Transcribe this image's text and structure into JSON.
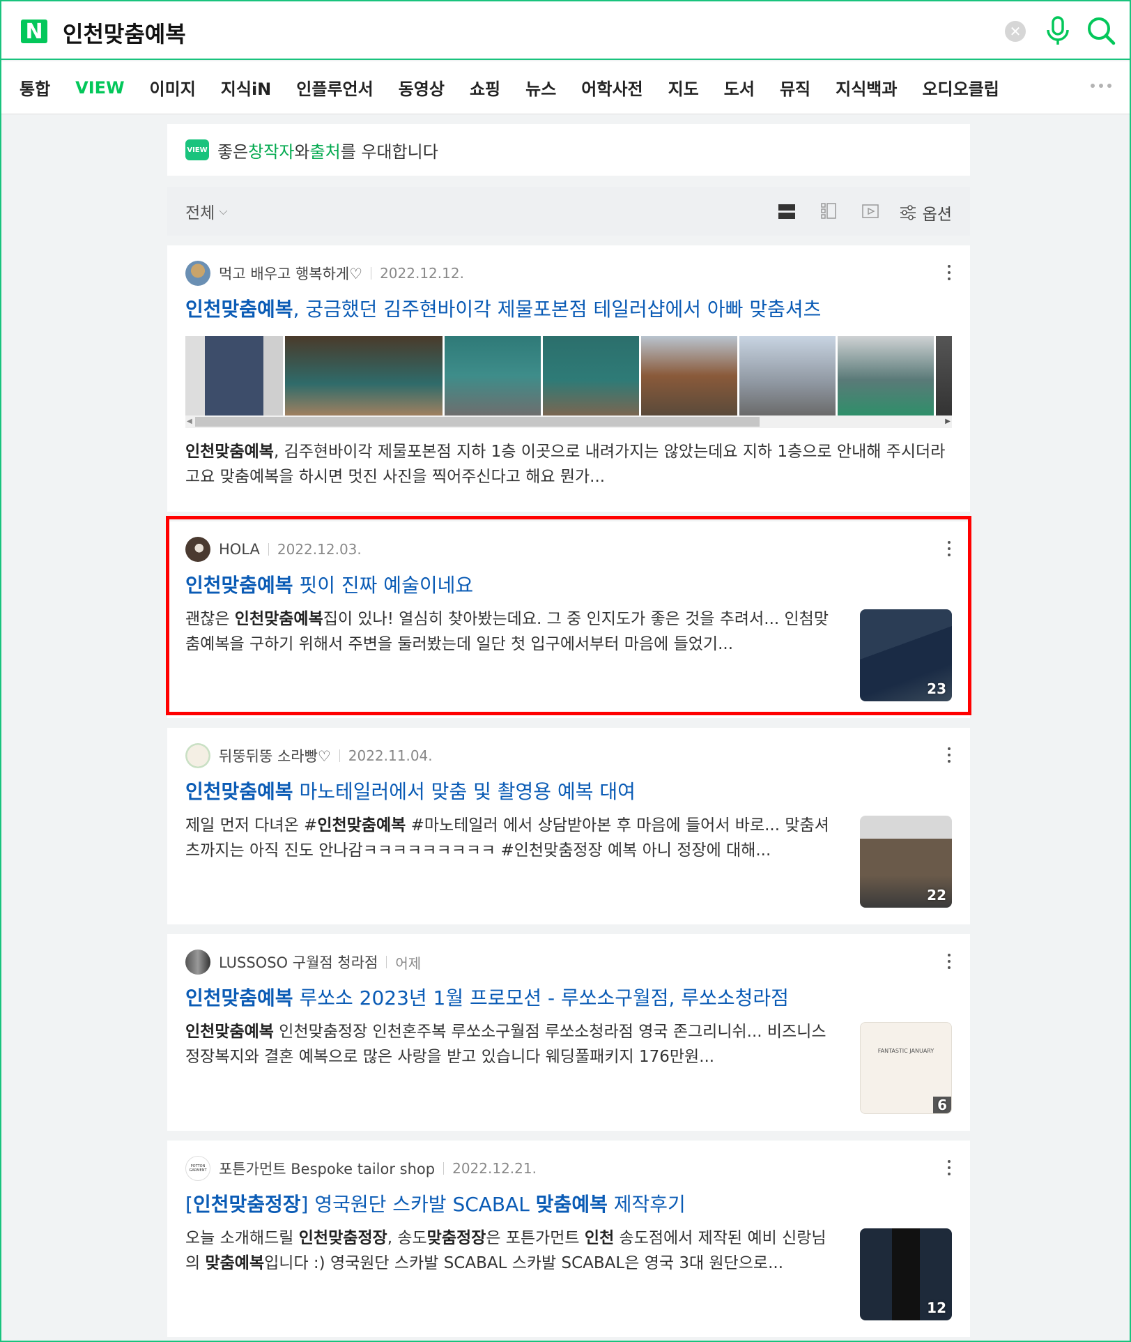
{
  "search": {
    "logo": "N",
    "query": "인천맞춤예복",
    "clear_icon": "close-icon",
    "mic_icon": "mic-icon",
    "search_icon": "search-icon",
    "accent": "#03c75a"
  },
  "nav": {
    "items": [
      "통합",
      "VIEW",
      "이미지",
      "지식iN",
      "인플루언서",
      "동영상",
      "쇼핑",
      "뉴스",
      "어학사전",
      "지도",
      "도서",
      "뮤직",
      "지식백과",
      "오디오클립"
    ],
    "active": "VIEW"
  },
  "notice": {
    "badge": "VIEW",
    "text_1": "좋은 ",
    "green_1": "창작자",
    "text_2": "와 ",
    "green_2": "출처",
    "text_3": "를 우대합니다"
  },
  "filter": {
    "label": "전체",
    "options_label": "옵션"
  },
  "results": [
    {
      "author": "먹고 배우고 행복하게♡",
      "date": "2022.12.12.",
      "title_bold": "인천맞춤예복",
      "title_rest": ", 궁금했던 김주현바이각 제물포본점 테일러샵에서 아빠 맞춤셔츠",
      "desc_bold": "인천맞춤예복",
      "desc_rest": ", 김주현바이각 제물포본점 지하 1층 이곳으로 내려가지는 않았는데요 지하 1층으로 안내해 주시더라고요 맞춤예복을 하시면 멋진 사진을 찍어주신다고 해요 뭔가..."
    },
    {
      "author": "HOLA",
      "date": "2022.12.03.",
      "title_bold": "인천맞춤예복",
      "title_rest": " 핏이 진짜 예술이네요",
      "desc_pre": "괜찮은 ",
      "desc_bold": "인천맞춤예복",
      "desc_rest": "집이 있나! 열심히 찾아봤는데요. 그 중 인지도가 좋은 것을 추려서... 인첨맞춤예복을 구하기 위해서 주변을 둘러봤는데 일단 첫 입구에서부터 마음에 들었기...",
      "count": "23"
    },
    {
      "author": "뒤뚱뒤뚱 소라빵♡",
      "date": "2022.11.04.",
      "title_bold": "인천맞춤예복",
      "title_rest": " 마노테일러에서 맞춤 및 촬영용 예복 대여",
      "desc_pre": "제일 먼저 다녀온 #",
      "desc_bold": "인천맞춤예복",
      "desc_rest": " #마노테일러 에서 상담받아본 후 마음에 들어서 바로... 맞춤셔츠까지는 아직 진도 안나감ㅋㅋㅋㅋㅋㅋㅋㅋㅋ #인천맞춤정장 예복 아니 정장에 대해...",
      "count": "22"
    },
    {
      "author": "LUSSOSO 구월점 청라점",
      "date": "어제",
      "title_bold": "인천맞춤예복",
      "title_rest": " 루쏘소 2023년 1월 프로모션 - 루쏘소구월점, 루쏘소청라점",
      "desc_pre": "",
      "desc_bold": "인천맞춤예복",
      "desc_rest": " 인천맞춤정장 인천혼주복 루쏘소구월점 루쏘소청라점 영국 존그리니쉬... 비즈니스 정장복지와 결혼 예복으로 많은 사랑을 받고 있습니다 웨딩풀패키지 176만원...",
      "count": "6",
      "thumb_text": "FANTASTIC JANUARY"
    },
    {
      "author": "포튼가먼트 Bespoke tailor shop",
      "date": "2022.12.21.",
      "title_pre": "[",
      "title_bold": "인천맞춤정장",
      "title_mid": "] 영국원단 스카발 SCABAL ",
      "title_bold2": "맞춤예복",
      "title_rest": " 제작후기",
      "desc_1": "오늘 소개해드릴 ",
      "desc_b1": "인천맞춤정장",
      "desc_2": ", 송도",
      "desc_b2": "맞춤정장",
      "desc_3": "은 포튼가먼트 ",
      "desc_b3": "인천",
      "desc_4": " 송도점에서 제작된 예비 신랑님의 ",
      "desc_b4": "맞춤예복",
      "desc_5": "입니다 :) 영국원단 스카발 SCABAL 스카발 SCABAL은 영국 3대 원단으로...",
      "count": "12",
      "avatar_text": "POTTON GARMENT"
    }
  ]
}
